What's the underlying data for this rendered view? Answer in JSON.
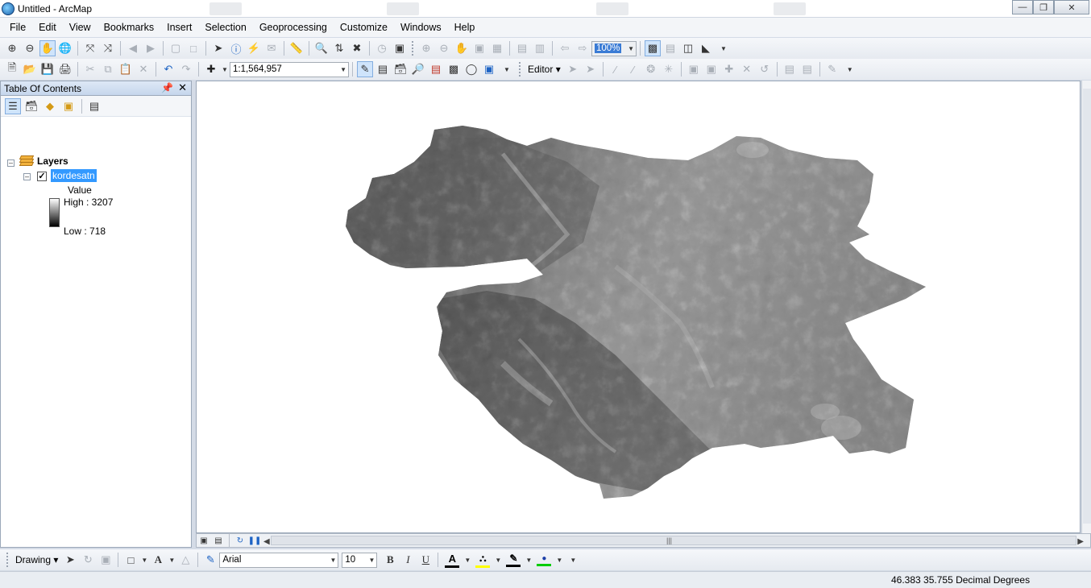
{
  "window": {
    "title": "Untitled - ArcMap",
    "buttons": [
      "minimize",
      "maximize",
      "close"
    ]
  },
  "menubar": {
    "items": [
      "File",
      "Edit",
      "View",
      "Bookmarks",
      "Insert",
      "Selection",
      "Geoprocessing",
      "Customize",
      "Windows",
      "Help"
    ]
  },
  "toolbar": {
    "zoom_combo_value": "100%",
    "scale_value": "1:1,564,957",
    "editor_label": "Editor"
  },
  "toc": {
    "title": "Table Of Contents",
    "root_label": "Layers",
    "layer_name": "kordesatn",
    "layer_checked": true,
    "legend_field": "Value",
    "legend_high": "High : 3207",
    "legend_low": "Low : 718"
  },
  "drawing": {
    "label": "Drawing",
    "font_name": "Arial",
    "font_size": "10",
    "bold": "B",
    "italic": "I",
    "underline": "U",
    "font_color_glyph": "A",
    "colors": {
      "font": "#000000",
      "fill": "#ffff00",
      "line": "#000000",
      "marker": "#00cc00"
    }
  },
  "statusbar": {
    "coordinates": "46.383  35.755 Decimal Degrees"
  },
  "colors": {
    "chrome": "#d4dbe6",
    "selection": "#3399ff"
  }
}
